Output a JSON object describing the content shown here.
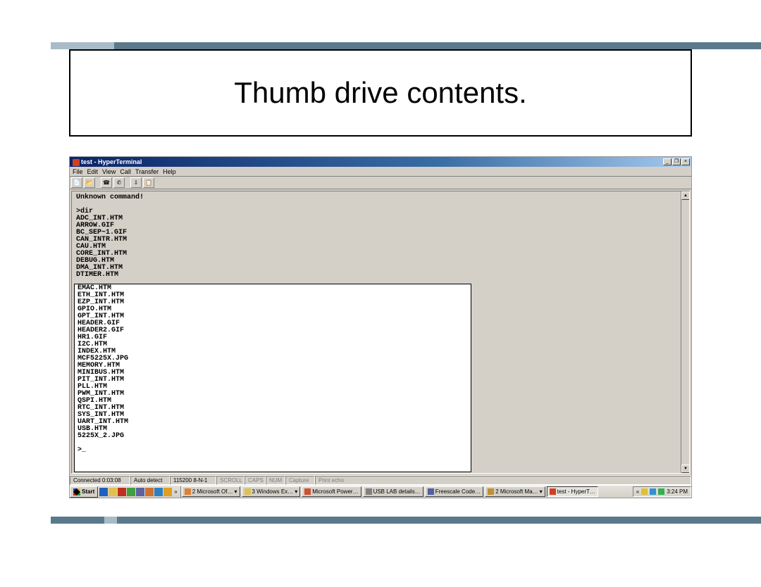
{
  "slide": {
    "title": "Thumb drive contents."
  },
  "window": {
    "title": "test - HyperTerminal",
    "controls": {
      "min": "_",
      "max": "❐",
      "close": "×"
    }
  },
  "menu": [
    "File",
    "Edit",
    "View",
    "Call",
    "Transfer",
    "Help"
  ],
  "terminal": {
    "pre_lines": "Unknown command!\n\n>dir\nADC_INT.HTM\nARROW.GIF\nBC_SEP~1.GIF\nCAN_INTR.HTM\nCAU.HTM\nCORE_INT.HTM\nDEBUG.HTM\nDMA_INT.HTM\nDTIMER.HTM",
    "overlay_lines": "EMAC.HTM\nETH_INT.HTM\nEZP_INT.HTM\nGPIO.HTM\nGPT_INT.HTM\nHEADER.GIF\nHEADER2.GIF\nHR1.GIF\nI2C.HTM\nINDEX.HTM\nMCF5225X.JPG\nMEMORY.HTM\nMINIBUS.HTM\nPIT_INT.HTM\nPLL.HTM\nPWM_INT.HTM\nQSPI.HTM\nRTC_INT.HTM\nSYS_INT.HTM\nUART_INT.HTM\nUSB.HTM\n5225X_2.JPG\n\n>_"
  },
  "status": {
    "connected": "Connected 0:03:08",
    "detect": "Auto detect",
    "baud": "115200 8-N-1",
    "scroll": "SCROLL",
    "caps": "CAPS",
    "num": "NUM",
    "capture": "Capture",
    "printecho": "Print echo"
  },
  "taskbar": {
    "start": "Start",
    "tasks": [
      {
        "label": "2 Microsoft Of…",
        "active": false,
        "group": "2"
      },
      {
        "label": "3 Windows Ex…",
        "active": false,
        "group": "3"
      },
      {
        "label": "Microsoft Power…",
        "active": false
      },
      {
        "label": "USB LAB details…",
        "active": false
      },
      {
        "label": "Freescale Code…",
        "active": false
      },
      {
        "label": "2 Microsoft Ma…",
        "active": false,
        "group": "2"
      },
      {
        "label": "test - HyperT…",
        "active": true
      }
    ],
    "tray_expand": "«",
    "clock": "3:24 PM"
  }
}
